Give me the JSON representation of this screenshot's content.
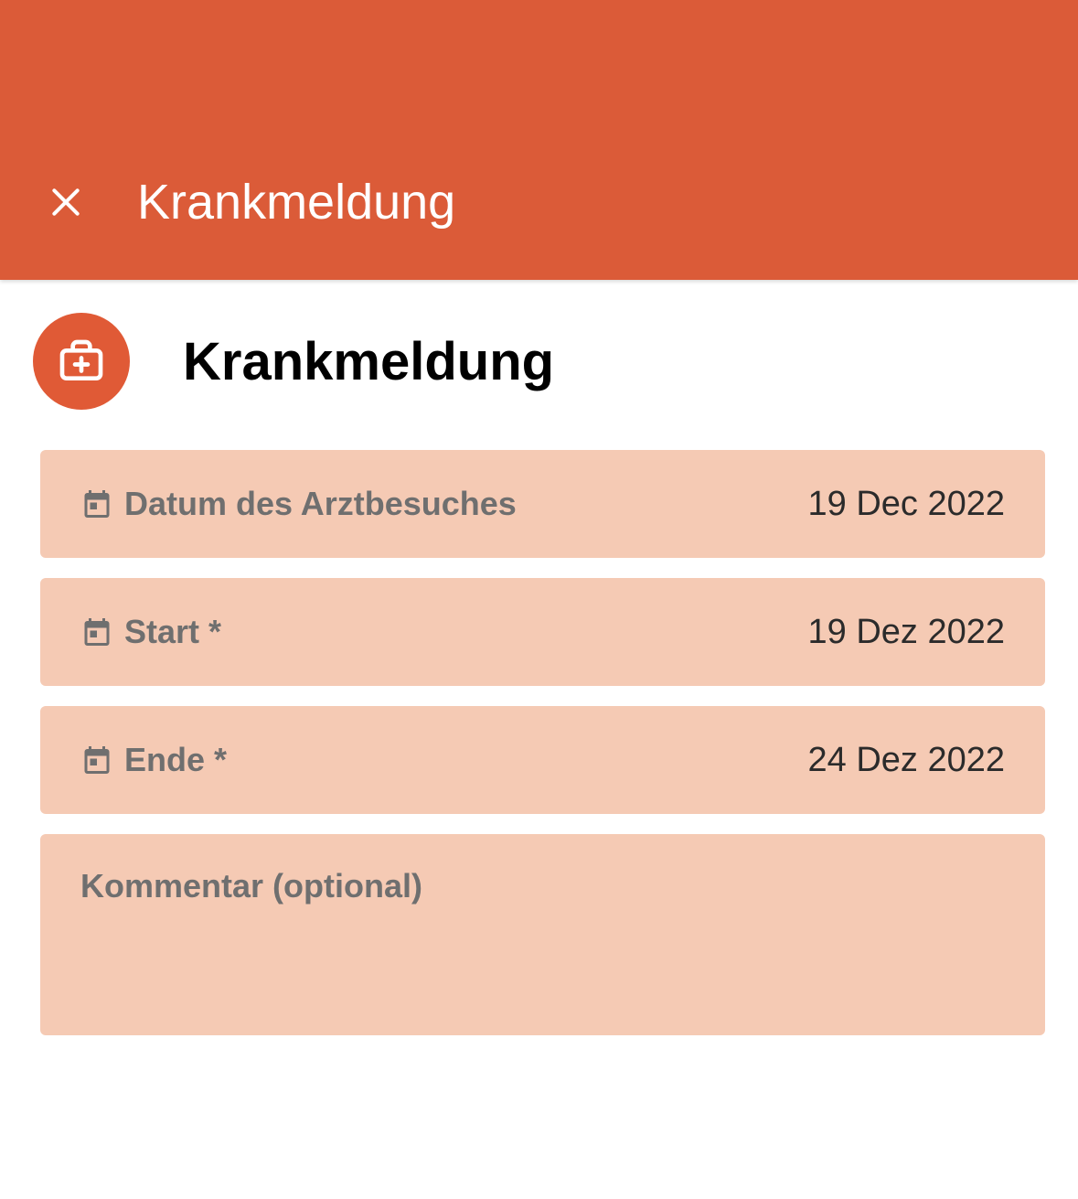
{
  "header": {
    "title": "Krankmeldung"
  },
  "page": {
    "title": "Krankmeldung"
  },
  "fields": {
    "doctor_visit": {
      "label": "Datum des Arztbesuches",
      "value": "19 Dec 2022"
    },
    "start": {
      "label": "Start *",
      "value": "19 Dez 2022"
    },
    "end": {
      "label": "Ende *",
      "value": "24 Dez 2022"
    },
    "comment": {
      "label": "Kommentar (optional)"
    }
  },
  "colors": {
    "primary": "#db5b38",
    "field_bg": "#f5cab4",
    "label": "#6f6f6f",
    "value": "#2b2b2b"
  }
}
